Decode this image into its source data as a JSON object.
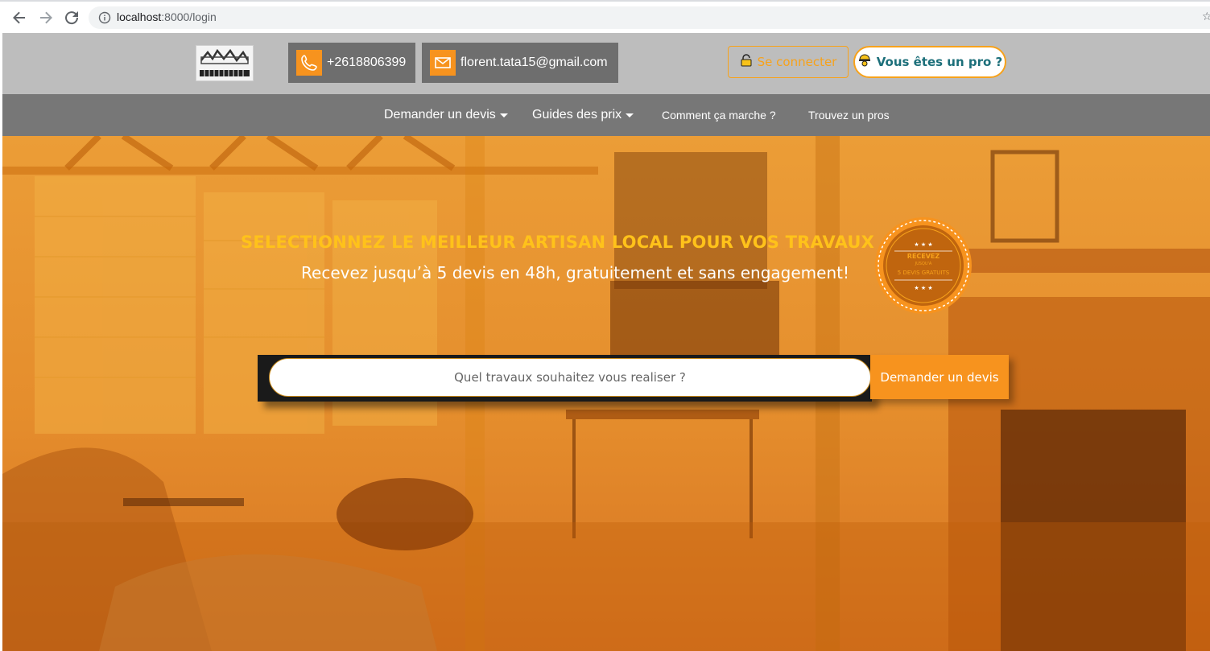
{
  "browser": {
    "url_host": "localhost",
    "url_rest": ":8000/login"
  },
  "header": {
    "phone": "+2618806399",
    "email": "florent.tata15@gmail.com",
    "login_label": "Se connecter",
    "pro_label": "Vous êtes un pro ?"
  },
  "nav": {
    "items": [
      {
        "label": "Demander un devis",
        "dropdown": true
      },
      {
        "label": "Guides des prix",
        "dropdown": true
      },
      {
        "label": "Comment ça marche ?",
        "dropdown": false
      },
      {
        "label": "Trouvez un pros",
        "dropdown": false
      }
    ]
  },
  "hero": {
    "title": "SELECTIONNEZ LE MEILLEUR ARTISAN LOCAL POUR VOS TRAVAUX",
    "subtitle": "Recevez jusqu’à 5 devis en 48h, gratuitement et sans engagement!",
    "badge": {
      "stars": "★ ★ ★",
      "line1": "RECEVEZ",
      "line2": "JUSQU'A",
      "line3": "5 DEVIS GRATUITS"
    },
    "search_placeholder": "Quel travaux souhaitez vous realiser ?",
    "search_button": "Demander un devis"
  },
  "colors": {
    "accent": "#f7931e",
    "header_bg": "#bdbdbd",
    "nav_bg": "#777777",
    "title_yellow": "#ffc21a",
    "pro_text": "#1c6f7a"
  }
}
